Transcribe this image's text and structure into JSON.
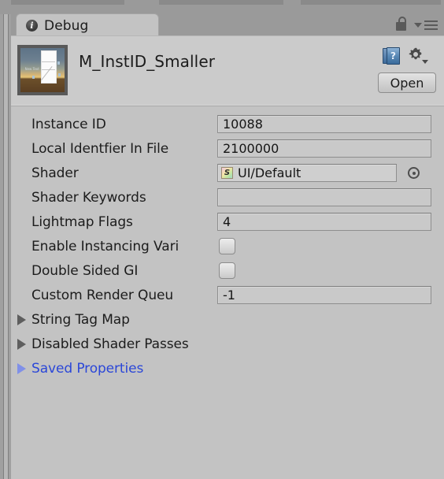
{
  "window": {
    "tab": {
      "label": "Debug",
      "icon": "info-icon"
    },
    "lock_icon": "lock-icon",
    "menu_icon": "hamburger-menu-icon"
  },
  "header": {
    "title": "M_InstID_Smaller",
    "preview_label": "New Text",
    "help_icon": "help-book-icon",
    "help_glyph": "?",
    "gear_icon": "gear-icon",
    "open_button": "Open"
  },
  "properties": [
    {
      "label": "Instance ID",
      "type": "text",
      "value": "10088"
    },
    {
      "label": "Local Identfier In File",
      "type": "text",
      "value": "2100000"
    },
    {
      "label": "Shader",
      "type": "object",
      "value": "UI/Default",
      "icon_glyph": "S"
    },
    {
      "label": "Shader Keywords",
      "type": "text",
      "value": ""
    },
    {
      "label": "Lightmap Flags",
      "type": "text",
      "value": "4"
    },
    {
      "label": "Enable Instancing Vari",
      "type": "checkbox",
      "checked": false
    },
    {
      "label": "Double Sided GI",
      "type": "checkbox",
      "checked": false
    },
    {
      "label": "Custom Render Queu",
      "type": "text",
      "value": "-1"
    }
  ],
  "foldouts": [
    {
      "label": "String Tag Map",
      "expanded": false,
      "accent": false
    },
    {
      "label": "Disabled Shader Passes",
      "expanded": false,
      "accent": false
    },
    {
      "label": "Saved Properties",
      "expanded": false,
      "accent": true
    }
  ],
  "colors": {
    "panel_bg": "#c3c3c3",
    "chrome_bg": "#9a9a9a",
    "header_bg": "#cbcbcb",
    "field_bg": "#c9c9c9",
    "accent_blue": "#2b47d8",
    "accent_triangle": "#8090e8"
  }
}
